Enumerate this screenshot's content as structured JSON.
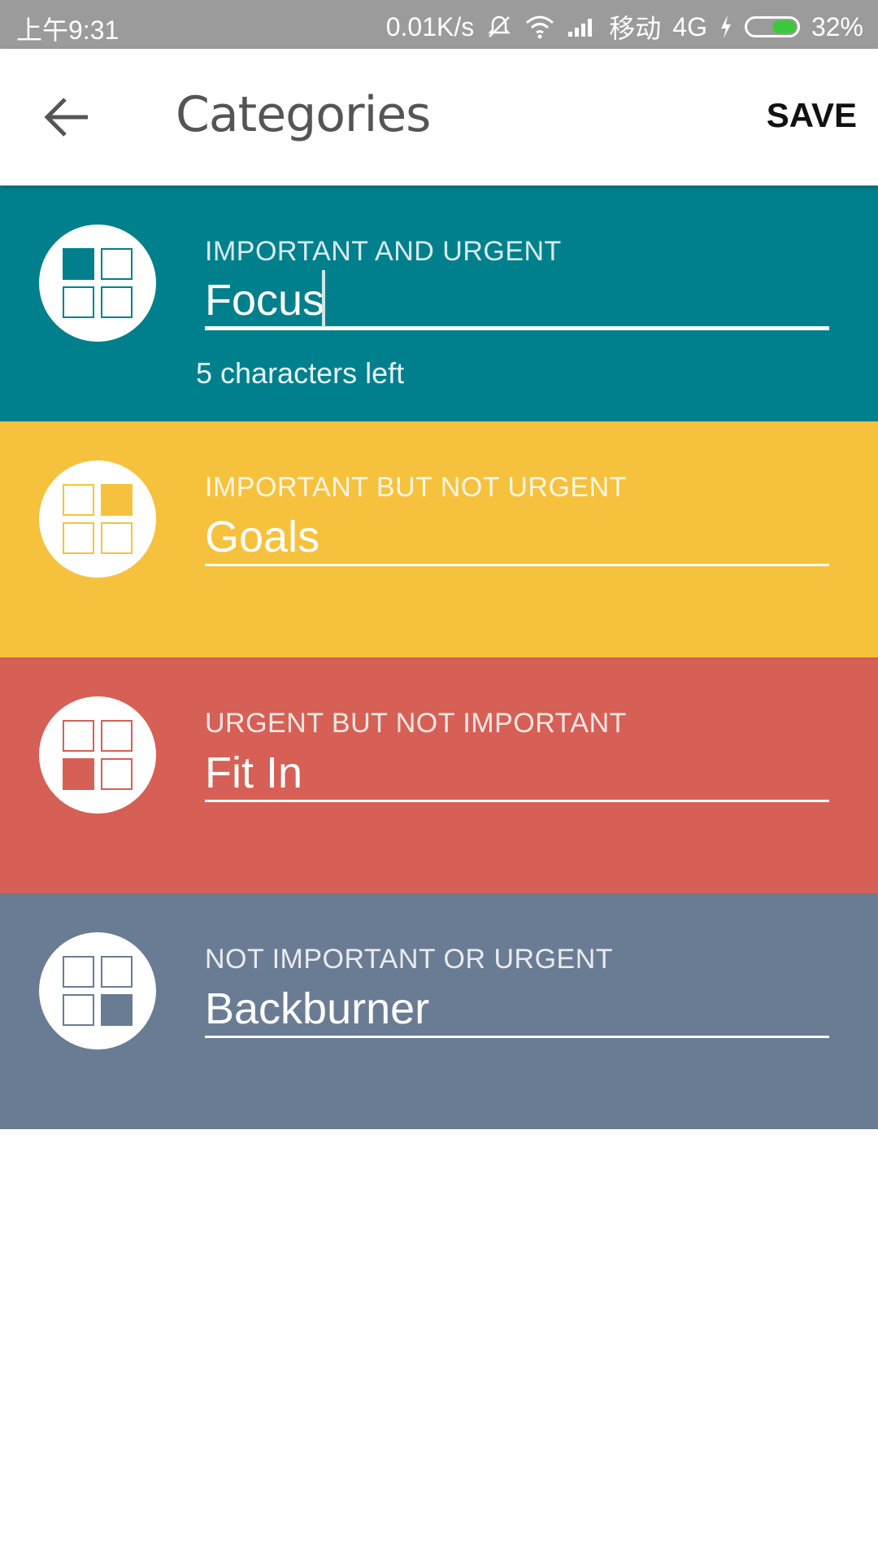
{
  "status_bar": {
    "time": "上午9:31",
    "speed": "0.01K/s",
    "carrier": "移动",
    "network": "4G",
    "battery": "32%",
    "battery_level": 0.32
  },
  "toolbar": {
    "back_icon": "arrow-left-icon",
    "title": "Categories",
    "save_label": "SAVE"
  },
  "categories": [
    {
      "label": "IMPORTANT AND URGENT",
      "value": "Focus",
      "helper": "5 characters left",
      "color": "#00808C",
      "filled_cell": 0,
      "icon": "quadrant-top-left-icon"
    },
    {
      "label": "IMPORTANT BUT NOT URGENT",
      "value": "Goals",
      "color": "#F6C23D",
      "filled_cell": 1,
      "icon": "quadrant-top-right-icon"
    },
    {
      "label": "URGENT BUT NOT IMPORTANT",
      "value": "Fit In",
      "color": "#D66055",
      "filled_cell": 2,
      "icon": "quadrant-bottom-left-icon"
    },
    {
      "label": "NOT IMPORTANT OR URGENT",
      "value": "Backburner",
      "color": "#6A7C93",
      "filled_cell": 3,
      "icon": "quadrant-bottom-right-icon"
    }
  ]
}
